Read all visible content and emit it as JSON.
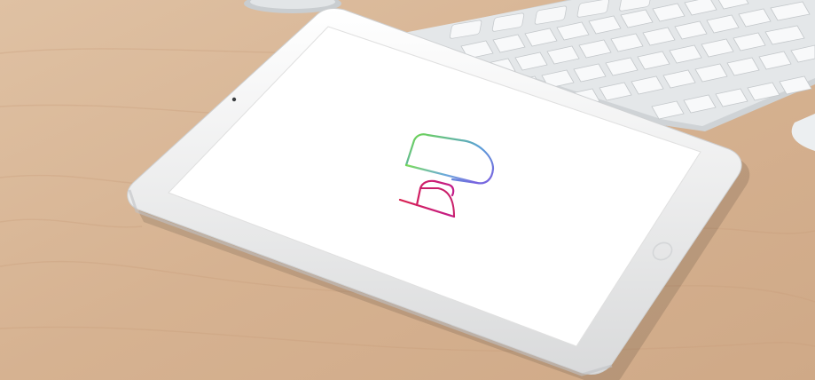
{
  "scene": {
    "description_shown": "",
    "colors": {
      "desk": "#d8b595",
      "desk_light": "#e3c6a8",
      "desk_dark": "#c79e7a",
      "tablet_body": "#f4f4f4",
      "screen": "#ffffff",
      "keyboard_base": "#cfd3d6",
      "key": "#f6f7f8",
      "monitor_stand": "#c9cdd0"
    }
  },
  "tablet_screen": {
    "logo_colors": [
      "#7bd34a",
      "#8a6fe0",
      "#3f6bd9",
      "#d9204f",
      "#c21d69"
    ]
  }
}
